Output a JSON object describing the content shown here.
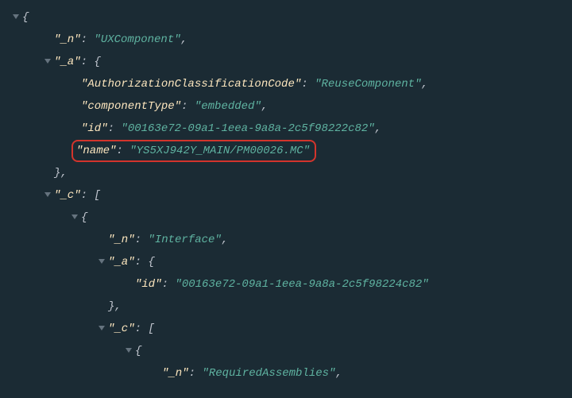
{
  "root": {
    "n_key": "\"_n\"",
    "n_val": "\"UXComponent\"",
    "a_key": "\"_a\"",
    "a": {
      "auth_key": "\"AuthorizationClassificationCode\"",
      "auth_val": "\"ReuseComponent\"",
      "ctype_key": "\"componentType\"",
      "ctype_val": "\"embedded\"",
      "id_key": "\"id\"",
      "id_val": "\"00163e72-09a1-1eea-9a8a-2c5f98222c82\"",
      "name_key": "\"name\"",
      "name_val": "\"YS5XJ942Y_MAIN/PM00026.MC\""
    },
    "c_key": "\"_c\"",
    "c0": {
      "n_key": "\"_n\"",
      "n_val": "\"Interface\"",
      "a_key": "\"_a\"",
      "a": {
        "id_key": "\"id\"",
        "id_val": "\"00163e72-09a1-1eea-9a8a-2c5f98224c82\""
      },
      "c_key": "\"_c\"",
      "c0": {
        "n_key": "\"_n\"",
        "n_val": "\"RequiredAssemblies\""
      }
    }
  },
  "sym": {
    "colon_sp": ": ",
    "comma": ",",
    "obrace": "{",
    "cbrace": "}",
    "obracket": "[",
    "cbracket": "]"
  }
}
